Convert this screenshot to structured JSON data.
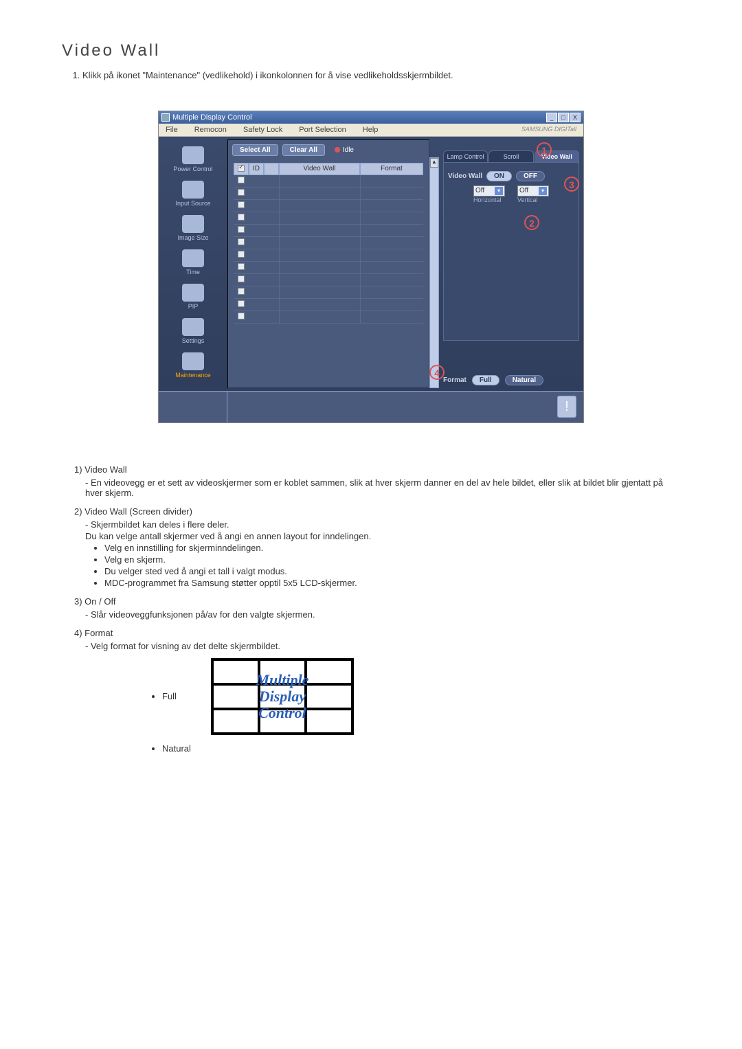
{
  "page": {
    "title": "Video Wall",
    "intro_item": "Klikk på ikonet \"Maintenance\" (vedlikehold) i ikonkolonnen for å vise vedlikeholdsskjermbildet."
  },
  "app": {
    "title": "Multiple Display Control",
    "brand": "SAMSUNG DIGITall",
    "menu": {
      "file": "File",
      "remocon": "Remocon",
      "safety": "Safety Lock",
      "port": "Port Selection",
      "help": "Help"
    },
    "sidebar": {
      "power": "Power Control",
      "input": "Input Source",
      "image": "Image Size",
      "time": "Time",
      "pip": "PIP",
      "settings": "Settings",
      "maintenance": "Maintenance"
    },
    "toolbar": {
      "select_all": "Select All",
      "clear_all": "Clear All",
      "idle": "Idle"
    },
    "grid_headers": {
      "id": "ID",
      "video_wall": "Video Wall",
      "format": "Format"
    },
    "tabs": {
      "lamp": "Lamp Control",
      "scroll": "Scroll",
      "video_wall": "Video Wall"
    },
    "panel": {
      "video_wall_label": "Video Wall",
      "on": "ON",
      "off": "OFF",
      "horiz_value": "Off",
      "vert_value": "Off",
      "horiz_label": "Horizontal",
      "vert_label": "Vertical",
      "format_label": "Format",
      "full": "Full",
      "natural": "Natural"
    },
    "callouts": {
      "c1": "1",
      "c2": "2",
      "c3": "3",
      "c4": "4"
    }
  },
  "explain": {
    "i1_title": "1)  Video Wall",
    "i1_dash": "- En videovegg er et sett av videoskjermer som er koblet sammen, slik at hver skjerm danner en del av hele bildet, eller slik at bildet blir gjentatt på hver skjerm.",
    "i2_title": "2)  Video Wall (Screen divider)",
    "i2_dash": "- Skjermbildet kan deles i flere deler.",
    "i2_line": "Du kan velge antall skjermer ved å angi en annen layout for inndelingen.",
    "i2_b1": "Velg en innstilling for skjerminndelingen.",
    "i2_b2": "Velg en skjerm.",
    "i2_b3": "Du velger sted ved å angi et tall i valgt modus.",
    "i2_b4": "MDC-programmet fra Samsung støtter opptil 5x5 LCD-skjermer.",
    "i3_title": "3)  On / Off",
    "i3_dash": "- Slår videoveggfunksjonen på/av for den valgte skjermen.",
    "i4_title": "4)  Format",
    "i4_dash": "- Velg format for visning av det delte skjermbildet.",
    "full_label": "Full",
    "natural_label": "Natural",
    "demo_l1": "Multiple",
    "demo_l2": "Display",
    "demo_l3": "Control"
  }
}
